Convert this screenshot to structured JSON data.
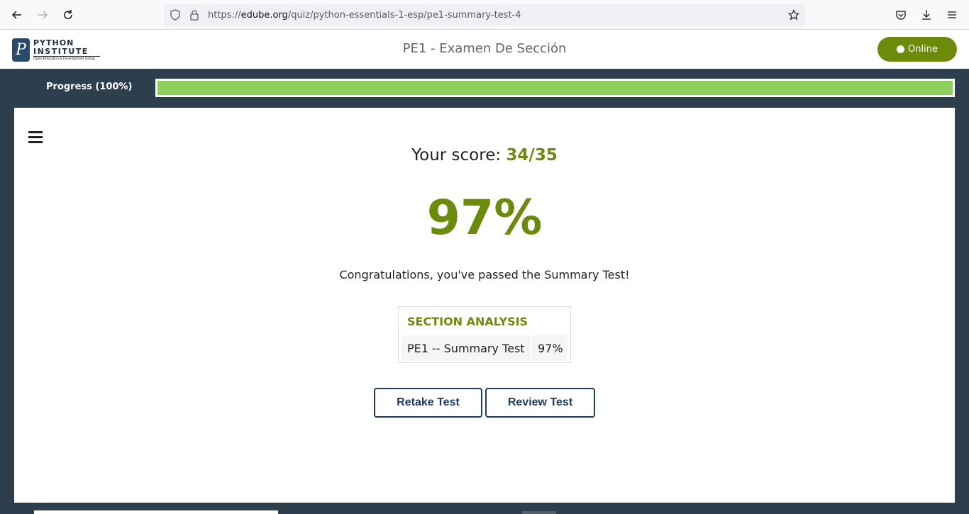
{
  "browser": {
    "url_prefix": "https://",
    "url_domain": "edube.org",
    "url_path": "/quiz/python-essentials-1-esp/pe1-summary-test-4"
  },
  "header": {
    "logo_line1": "PYTHON",
    "logo_line2": "INSTITUTE",
    "logo_line3": "Open Education & Development Group",
    "logo_mark": "P",
    "title": "PE1 - Examen De Sección",
    "status_label": "Online"
  },
  "progress": {
    "label": "Progress (100%)",
    "fraction": 1.0
  },
  "result": {
    "score_prefix": "Your score: ",
    "score_value": "34/35",
    "percent": "97%",
    "message": "Congratulations, you've passed the Summary Test!"
  },
  "analysis": {
    "heading": "SECTION ANALYSIS",
    "rows": [
      {
        "name": "PE1 -- Summary Test",
        "percent": "97%"
      }
    ]
  },
  "actions": {
    "retake_label": "Retake Test",
    "review_label": "Review Test"
  },
  "colors": {
    "accent": "#6d8b0b",
    "progress": "#8ccf5f",
    "navy": "#1e3d64",
    "background": "#2d3e4d"
  }
}
